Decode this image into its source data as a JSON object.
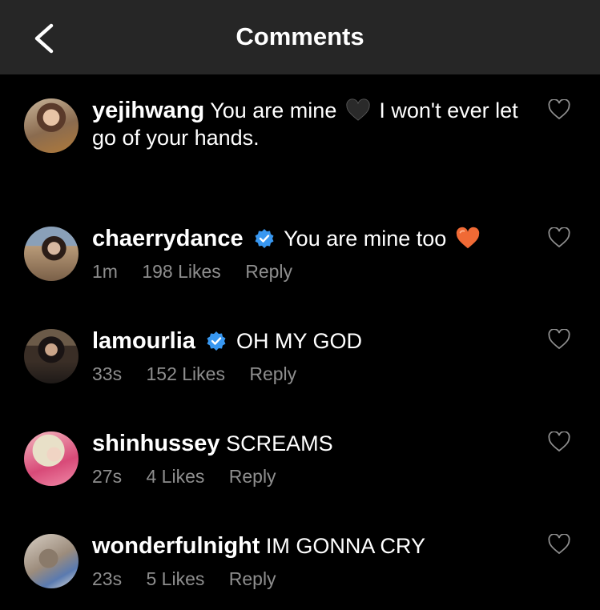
{
  "header": {
    "title": "Comments"
  },
  "comments": [
    {
      "user": "yejihwang",
      "text_before": "You are mine",
      "text_after": "I won't ever let go of your hands.",
      "emoji": "black-heart",
      "verified": false
    },
    {
      "user": "chaerrydance",
      "text_before": "You are mine too",
      "text_after": "",
      "emoji": "orange-heart",
      "verified": true,
      "time": "1m",
      "likes": "198 Likes",
      "reply": "Reply"
    },
    {
      "user": "lamourlia",
      "text_before": "OH MY GOD",
      "text_after": "",
      "verified": true,
      "time": "33s",
      "likes": "152 Likes",
      "reply": "Reply"
    },
    {
      "user": "shinhussey",
      "text_before": "SCREAMS",
      "text_after": "",
      "verified": false,
      "time": "27s",
      "likes": "4 Likes",
      "reply": "Reply"
    },
    {
      "user": "wonderfulnight",
      "text_before": "IM GONNA CRY",
      "text_after": "",
      "verified": false,
      "time": "23s",
      "likes": "5 Likes",
      "reply": "Reply"
    }
  ],
  "colors": {
    "background": "#000000",
    "header": "#262626",
    "meta": "#8e8e8e",
    "verified": "#3897f0",
    "orange_heart": "#f06a35"
  }
}
